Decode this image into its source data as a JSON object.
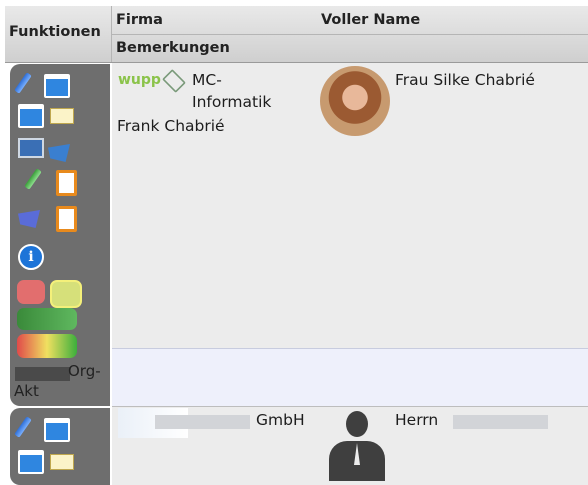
{
  "header": {
    "functions_label": "Funktionen",
    "company_label": "Firma",
    "fullname_label": "Voller Name",
    "remarks_label": "Bemerkungen"
  },
  "records": [
    {
      "logo_text": "wupp",
      "company_lines": [
        "MC-",
        "Informatik"
      ],
      "contact_name": "Frank Chabrié",
      "full_name": "Frau Silke Chabrié",
      "side_footer": [
        "Org-",
        "Akt"
      ]
    },
    {
      "company": "GmbH",
      "full_name": "Herrn"
    }
  ],
  "icons": {
    "edit": "pencil-icon",
    "window": "window-icon",
    "mail": "envelope-icon",
    "monitor": "monitor-icon",
    "clipboard": "clipboard-icon",
    "info": "info-icon",
    "info_glyph": "i"
  },
  "colors": {
    "selected_row": "#eef0fb",
    "function_panel": "#6e6e6e",
    "row_bg": "#ececec",
    "header_bg": "#dadada"
  }
}
